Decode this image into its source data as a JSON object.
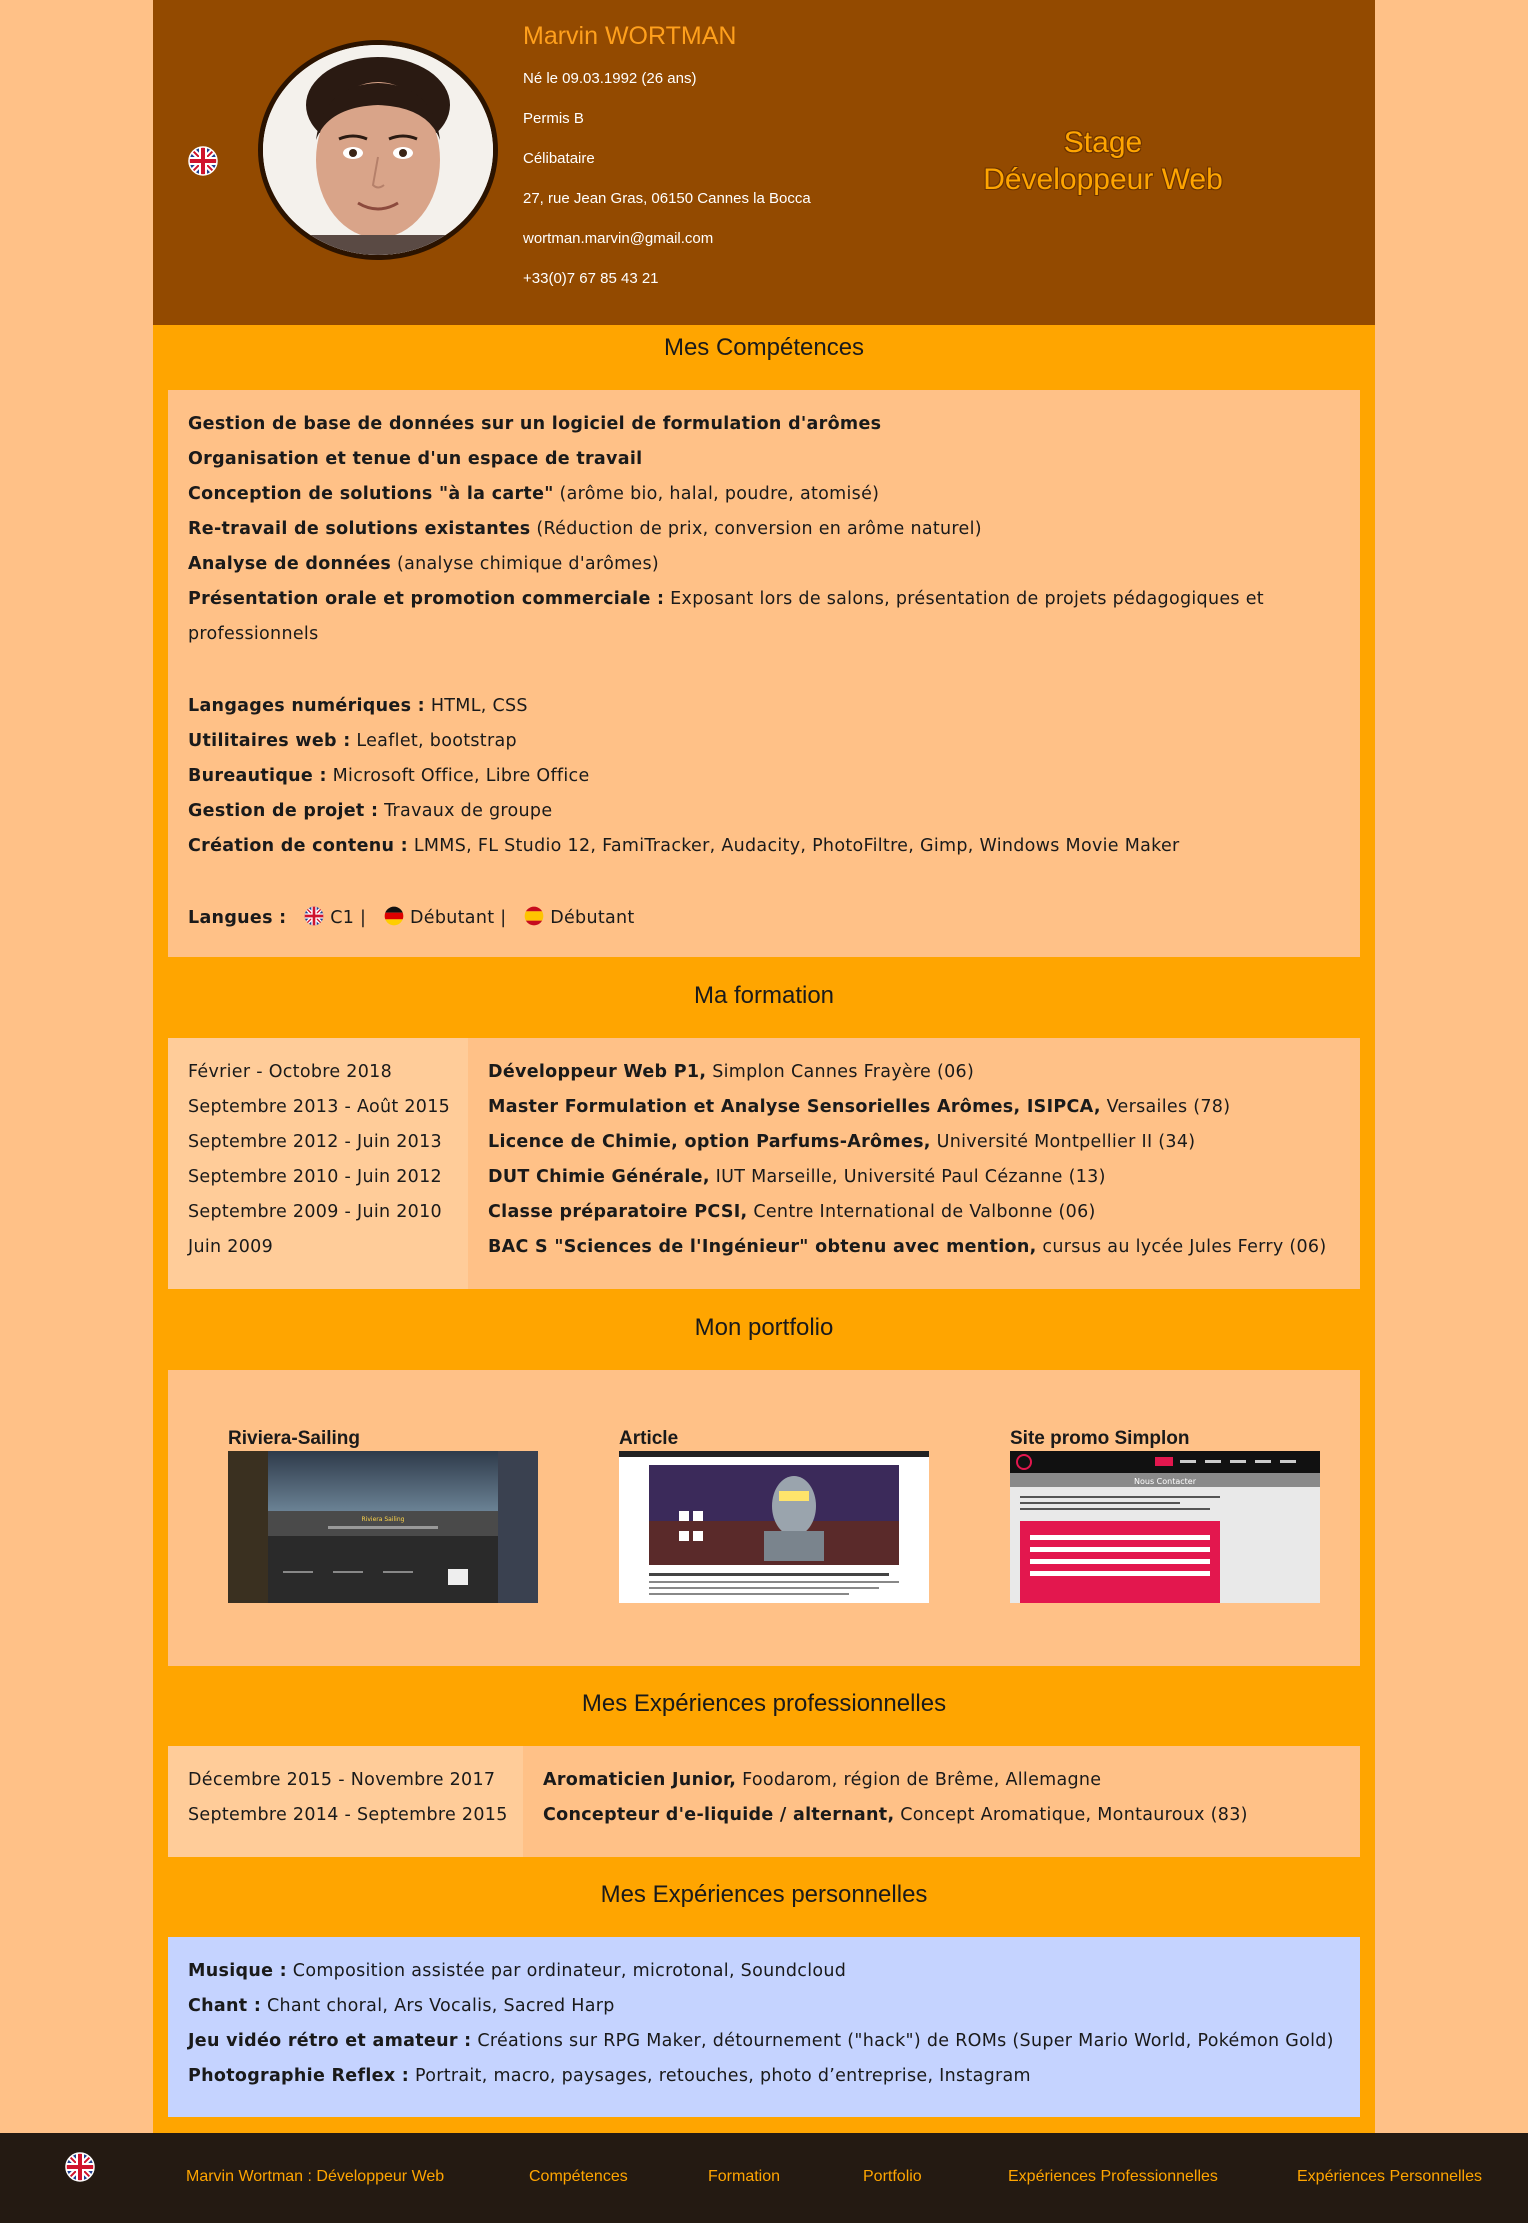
{
  "header": {
    "name": "Marvin WORTMAN",
    "info": [
      "Né le 09.03.1992 (26 ans)",
      "Permis B",
      "Célibataire",
      "27, rue Jean Gras, 06150 Cannes la Bocca",
      "wortman.marvin@gmail.com",
      "+33(0)7 67 85 43 21"
    ],
    "stage_line1": "Stage",
    "stage_line2": "Développeur Web"
  },
  "competences": {
    "title": "Mes Compétences",
    "items": [
      {
        "label": "Gestion de base de données sur un logiciel de formulation d'arômes",
        "detail": ""
      },
      {
        "label": "Organisation et tenue d'un espace de travail",
        "detail": ""
      },
      {
        "label": "Conception de solutions \"à la carte\"",
        "detail": " (arôme bio, halal, poudre, atomisé)"
      },
      {
        "label": "Re-travail de solutions existantes",
        "detail": " (Réduction de prix, conversion en arôme naturel)"
      },
      {
        "label": "Analyse de données",
        "detail": " (analyse chimique d'arômes)"
      },
      {
        "label": "Présentation orale et promotion commerciale :",
        "detail": " Exposant lors de salons, présentation de projets pédagogiques et"
      }
    ],
    "wrap_line": "professionnels",
    "tools": [
      {
        "label": "Langages numériques :",
        "detail": " HTML, CSS"
      },
      {
        "label": "Utilitaires web :",
        "detail": " Leaflet, bootstrap"
      },
      {
        "label": "Bureautique :",
        "detail": " Microsoft Office, Libre Office"
      },
      {
        "label": "Gestion de projet :",
        "detail": " Travaux de groupe"
      },
      {
        "label": "Création de contenu :",
        "detail": " LMMS, FL Studio 12, FamiTracker, Audacity, PhotoFiltre, Gimp, Windows Movie Maker"
      }
    ],
    "langues_label": "Langues :",
    "langues": [
      {
        "flag": "uk-flag",
        "level": "C1 |"
      },
      {
        "flag": "de-flag",
        "level": "Débutant |"
      },
      {
        "flag": "es-flag",
        "level": "Débutant"
      }
    ]
  },
  "formation": {
    "title": "Ma formation",
    "rows": [
      {
        "date": "Février - Octobre 2018",
        "label": "Développeur Web P1,",
        "detail": " Simplon Cannes Frayère (06)"
      },
      {
        "date": "Septembre 2013 - Août 2015",
        "label": "Master Formulation et Analyse Sensorielles Arômes, ISIPCA,",
        "detail": " Versailes (78)"
      },
      {
        "date": "Septembre 2012 - Juin 2013",
        "label": "Licence de Chimie, option Parfums-Arômes,",
        "detail": " Université Montpellier II (34)"
      },
      {
        "date": "Septembre 2010 - Juin 2012",
        "label": "DUT Chimie Générale,",
        "detail": " IUT Marseille, Université Paul Cézanne (13)"
      },
      {
        "date": "Septembre 2009 - Juin 2010",
        "label": "Classe préparatoire PCSI,",
        "detail": " Centre International de Valbonne (06)"
      },
      {
        "date": "Juin 2009",
        "label": "BAC S \"Sciences de l'Ingénieur\" obtenu avec mention,",
        "detail": " cursus au lycée Jules Ferry (06)"
      }
    ]
  },
  "portfolio": {
    "title": "Mon portfolio",
    "items": [
      {
        "title": "Riviera-Sailing"
      },
      {
        "title": "Article"
      },
      {
        "title": "Site promo Simplon"
      }
    ],
    "thumb_texts": {
      "sailing_heading": "Riviera Sailing",
      "simplon_heading": "Nous Contacter"
    }
  },
  "experiences_pro": {
    "title": "Mes Expériences professionnelles",
    "rows": [
      {
        "date": "Décembre 2015 - Novembre 2017",
        "label": "Aromaticien Junior,",
        "detail": " Foodarom, région de Brême, Allemagne"
      },
      {
        "date": "Septembre 2014 - Septembre 2015",
        "label": "Concepteur d'e-liquide / alternant,",
        "detail": " Concept Aromatique, Montauroux (83)"
      }
    ]
  },
  "experiences_perso": {
    "title": "Mes Expériences personnelles",
    "rows": [
      {
        "label": "Musique :",
        "detail": " Composition assistée par ordinateur, microtonal, Soundcloud"
      },
      {
        "label": "Chant :",
        "detail": " Chant choral, Ars Vocalis, Sacred Harp"
      },
      {
        "label": "Jeu vidéo rétro et amateur :",
        "detail": " Créations sur RPG Maker, détournement (\"hack\") de ROMs (Super Mario World, Pokémon Gold)"
      },
      {
        "label": "Photographie Reflex :",
        "detail": " Portrait, macro, paysages, retouches, photo d’entreprise, Instagram"
      }
    ]
  },
  "footer": {
    "links": [
      "Marvin Wortman : Développeur Web",
      "Compétences",
      "Formation",
      "Portfolio",
      "Expériences Professionnelles",
      "Expériences Personnelles"
    ]
  },
  "colors": {
    "page_bg": "#ffc187",
    "frame": "#ffa500",
    "header_bg": "#934a00",
    "accent": "#ffa01c",
    "perso_bg": "#c5d3ff",
    "footer_bg": "#241a12"
  }
}
